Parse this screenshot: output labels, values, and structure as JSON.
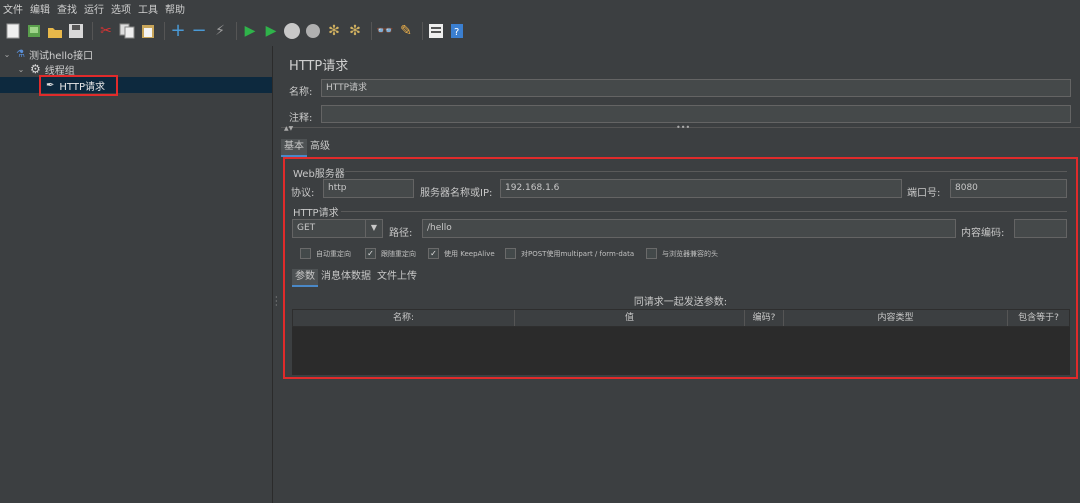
{
  "menu": [
    "文件",
    "编辑",
    "查找",
    "运行",
    "选项",
    "工具",
    "帮助"
  ],
  "toolbar_icons": [
    "new-icon",
    "templates-icon",
    "open-icon",
    "save-icon",
    "cut-icon",
    "copy-icon",
    "paste-icon",
    "expand-icon",
    "collapse-icon",
    "toggle-icon",
    "start-icon",
    "start-no-pause-icon",
    "stop-icon",
    "shutdown-icon",
    "clear-icon",
    "clear-all-icon",
    "search-icon",
    "reset-search-icon",
    "function-helper-icon",
    "help-icon"
  ],
  "tree": {
    "root": "测试hello接口",
    "thread_group": "线程组",
    "sampler": "HTTP请求"
  },
  "panel": {
    "title": "HTTP请求",
    "name_label": "名称:",
    "name_value": "HTTP请求",
    "comment_label": "注释:",
    "comment_value": "",
    "tabs": [
      "基本",
      "高级"
    ],
    "web_server": {
      "legend": "Web服务器",
      "protocol_label": "协议:",
      "protocol_value": "http",
      "server_label": "服务器名称或IP:",
      "server_value": "192.168.1.6",
      "port_label": "端口号:",
      "port_value": "8080"
    },
    "http_request": {
      "legend": "HTTP请求",
      "method": "GET",
      "path_label": "路径:",
      "path_value": "/hello",
      "encoding_label": "内容编码:",
      "encoding_value": ""
    },
    "checkboxes": [
      {
        "label": "自动重定向",
        "checked": false
      },
      {
        "label": "跟随重定向",
        "checked": true
      },
      {
        "label": "使用 KeepAlive",
        "checked": true
      },
      {
        "label": "对POST使用multipart / form-data",
        "checked": false
      },
      {
        "label": "与浏览器兼容的头",
        "checked": false
      }
    ],
    "sub_tabs": [
      "参数",
      "消息体数据",
      "文件上传"
    ],
    "params_caption": "同请求一起发送参数:",
    "columns": [
      "名称:",
      "值",
      "编码?",
      "内容类型",
      "包含等于?"
    ]
  }
}
